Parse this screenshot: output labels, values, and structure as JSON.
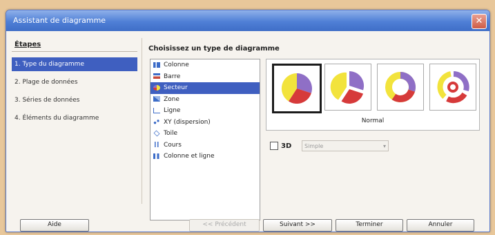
{
  "window": {
    "title": "Assistant de diagramme",
    "close_glyph": "✕"
  },
  "steps": {
    "title": "Étapes",
    "items": [
      {
        "label": "1. Type du diagramme"
      },
      {
        "label": "2. Plage de données"
      },
      {
        "label": "3. Séries de données"
      },
      {
        "label": "4. Éléments du diagramme"
      }
    ]
  },
  "chart_types": {
    "heading": "Choisissez un type de diagramme",
    "items": [
      {
        "label": "Colonne",
        "icon": "column-chart-icon"
      },
      {
        "label": "Barre",
        "icon": "bar-chart-icon"
      },
      {
        "label": "Secteur",
        "icon": "pie-chart-icon"
      },
      {
        "label": "Zone",
        "icon": "area-chart-icon"
      },
      {
        "label": "Ligne",
        "icon": "line-chart-icon"
      },
      {
        "label": "XY (dispersion)",
        "icon": "scatter-chart-icon"
      },
      {
        "label": "Toile",
        "icon": "net-chart-icon"
      },
      {
        "label": "Cours",
        "icon": "stock-chart-icon"
      },
      {
        "label": "Colonne et ligne",
        "icon": "column-line-chart-icon"
      }
    ],
    "selected_index": 2
  },
  "variants": {
    "items": [
      {
        "icon": "pie-normal-icon"
      },
      {
        "icon": "pie-exploded-icon"
      },
      {
        "icon": "donut-icon"
      },
      {
        "icon": "donut-exploded-icon"
      }
    ],
    "selected_index": 0,
    "label": "Normal"
  },
  "option_3d": {
    "label": "3D",
    "checked": false,
    "style_value": "Simple"
  },
  "buttons": {
    "help": "Aide",
    "back": "<< Précédent",
    "next": "Suivant >>",
    "finish": "Terminer",
    "cancel": "Annuler"
  },
  "colors": {
    "title_bar": "#4f7fd6",
    "selection": "#3f5fc0",
    "pie_yellow": "#f2e33c",
    "pie_purple": "#8f6fc6",
    "pie_red": "#d63a3a"
  }
}
